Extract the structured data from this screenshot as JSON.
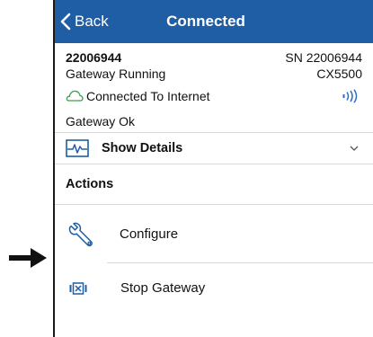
{
  "navbar": {
    "back_label": "Back",
    "title": "Connected",
    "color": "#1f5ea4"
  },
  "gateway": {
    "id": "22006944",
    "serial": "SN 22006944",
    "status": "Gateway Running",
    "model": "CX5500",
    "internet": "Connected To Internet",
    "health": "Gateway Ok"
  },
  "details": {
    "label": "Show Details"
  },
  "actions": {
    "title": "Actions",
    "items": [
      {
        "label": "Configure",
        "icon": "wrench-icon"
      },
      {
        "label": "Stop Gateway",
        "icon": "stop-gateway-icon"
      }
    ]
  },
  "icons": {
    "cloud": "cloud-icon",
    "signal": "signal-icon",
    "pulse": "pulse-icon",
    "caret": "chevron-down-icon",
    "pointer": "arrow-right-icon"
  },
  "colors": {
    "accent": "#1f5ea4",
    "cloud": "#3aa04a",
    "signal": "#2a6fc9"
  }
}
